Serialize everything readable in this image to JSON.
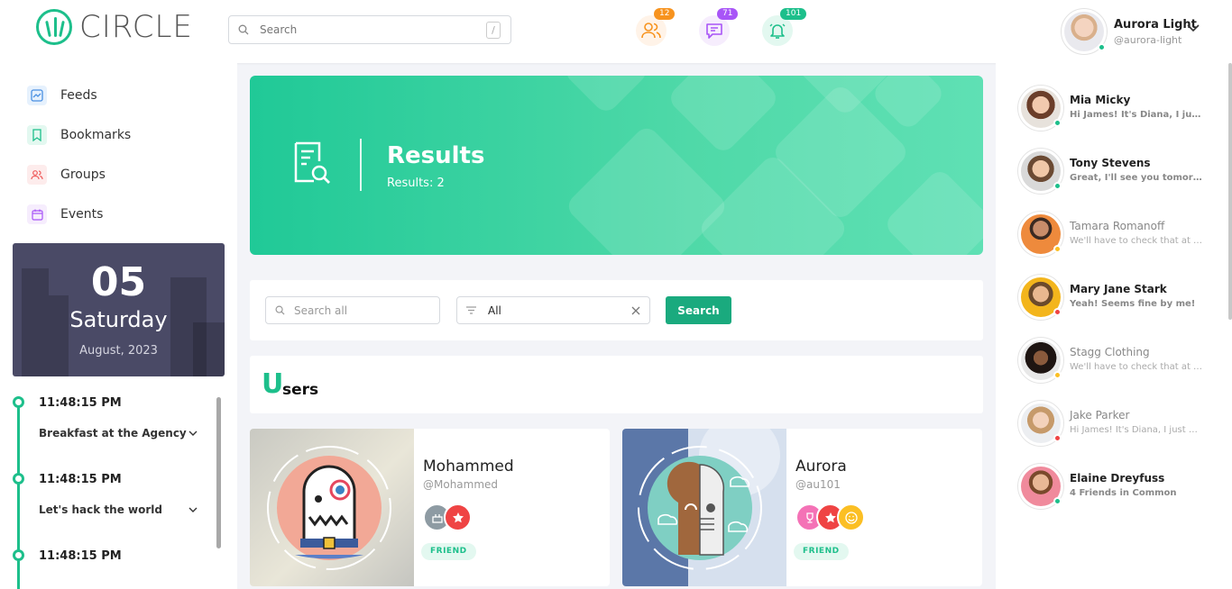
{
  "brand": {
    "name": "CIRCLE"
  },
  "header": {
    "search_placeholder": "Search",
    "search_shortcut": "/",
    "friends_count": "12",
    "messages_count": "71",
    "notifications_count": "101",
    "user": {
      "name": "Aurora Light",
      "handle": "@aurora-light"
    }
  },
  "sidebar": {
    "nav": [
      {
        "label": "Feeds"
      },
      {
        "label": "Bookmarks"
      },
      {
        "label": "Groups"
      },
      {
        "label": "Events"
      }
    ],
    "date": {
      "day": "05",
      "weekday": "Saturday",
      "month_year": "August, 2023"
    },
    "timeline": [
      {
        "time": "11:48:15 PM",
        "title": "Breakfast at the Agency"
      },
      {
        "time": "11:48:15 PM",
        "title": "Let's hack the world"
      },
      {
        "time": "11:48:15 PM",
        "title": ""
      }
    ]
  },
  "banner": {
    "title": "Results",
    "subtitle": "Results: 2"
  },
  "filters": {
    "search_placeholder": "Search all",
    "type_value": "All",
    "search_button": "Search"
  },
  "users_section": {
    "first_letter": "U",
    "rest": "sers"
  },
  "users": [
    {
      "name": "Mohammed",
      "handle": "@Mohammed",
      "tag": "FRIEND"
    },
    {
      "name": "Aurora",
      "handle": "@au101",
      "tag": "FRIEND"
    }
  ],
  "chats": [
    {
      "name": "Mia Micky",
      "message": "Hi James! It's Diana, I just wanted to let you know"
    },
    {
      "name": "Tony Stevens",
      "message": "Great, I'll see you tomorrow!."
    },
    {
      "name": "Tamara Romanoff",
      "message": "We'll have to check that at the office"
    },
    {
      "name": "Mary Jane Stark",
      "message": "Yeah! Seems fine by me!"
    },
    {
      "name": "Stagg Clothing",
      "message": "We'll have to check that at the office"
    },
    {
      "name": "Jake Parker",
      "message": "Hi James! It's Diana, I just wanted to let you know"
    },
    {
      "name": "Elaine Dreyfuss",
      "message": "4 Friends in Common"
    }
  ],
  "colors": {
    "accent": "#1dbf8b",
    "button": "#1aaa7e",
    "orange": "#f7931e",
    "purple": "#a855f7",
    "teal": "#1dbf8b"
  }
}
